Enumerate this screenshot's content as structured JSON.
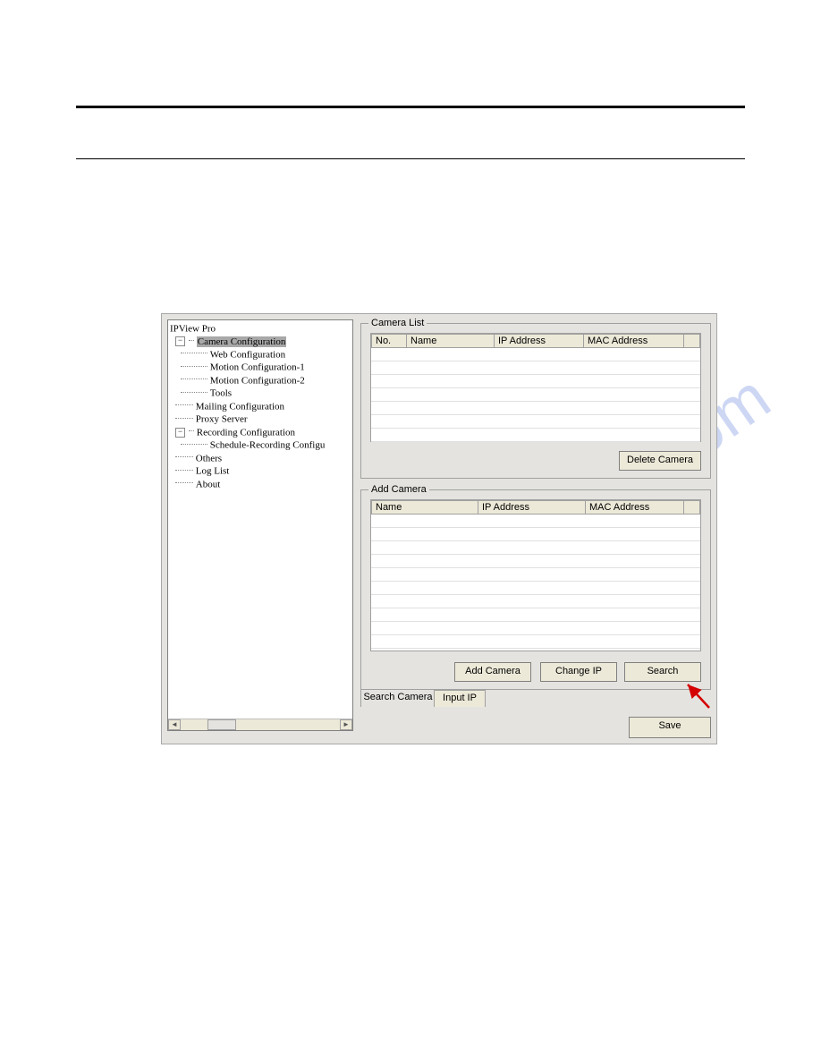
{
  "tree": {
    "root": "IPView Pro",
    "items": {
      "camera_config": "Camera Configuration",
      "web_config": "Web Configuration",
      "motion1": "Motion Configuration-1",
      "motion2": "Motion Configuration-2",
      "tools": "Tools",
      "mailing": "Mailing Configuration",
      "proxy": "Proxy Server",
      "recording": "Recording Configuration",
      "sched": "Schedule-Recording Configu",
      "others": "Others",
      "loglist": "Log List",
      "about": "About"
    }
  },
  "camera_list": {
    "title": "Camera List",
    "cols": {
      "no": "No.",
      "name": "Name",
      "ip": "IP Address",
      "mac": "MAC Address"
    },
    "delete_btn": "Delete Camera"
  },
  "add_camera": {
    "title": "Add Camera",
    "cols": {
      "name": "Name",
      "ip": "IP Address",
      "mac": "MAC Address"
    },
    "add_btn": "Add Camera",
    "changeip_btn": "Change IP",
    "search_btn": "Search"
  },
  "tabs": {
    "search": "Search Camera",
    "input": "Input IP"
  },
  "save_btn": "Save",
  "watermark": "manualshive.com"
}
